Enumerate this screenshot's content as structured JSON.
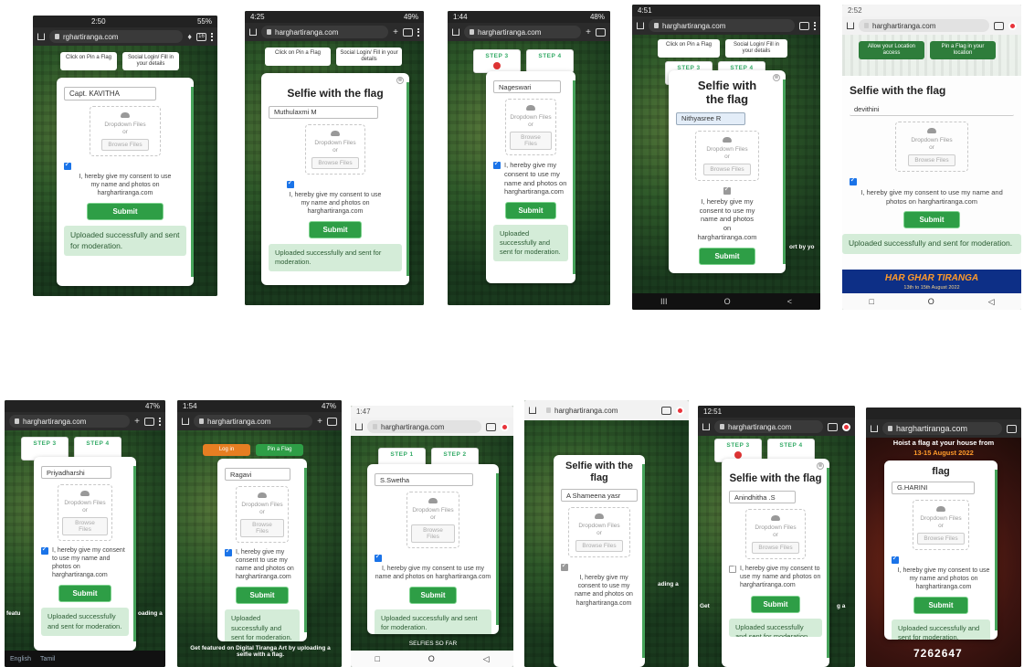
{
  "common": {
    "card_title": "Selfie with the flag",
    "drop_text": "Dropdown Files",
    "or_text": "or",
    "browse_label": "Browse Files",
    "consent_text": "I, hereby give my consent to use my name and photos on harghartiranga.com",
    "submit_label": "Submit",
    "uploaded_text": "Uploaded successfully and sent for moderation.",
    "close_label": "⊗"
  },
  "shots": [
    {
      "status_time": "2:50",
      "status_right": "55%",
      "url": "rghartiranga.com",
      "tabs": "16",
      "tab_labels": [
        "Click on Pin a Flag",
        "Social Login/ Fill in your details"
      ],
      "name": "Capt. KAVITHA"
    },
    {
      "status_time": "4:25",
      "status_right": "49%",
      "url": "harghartiranga.com",
      "tabs": "",
      "tab_labels": [
        "Click on Pin a Flag",
        "Social Login/ Fill in your details"
      ],
      "name": "Muthulaxmi M"
    },
    {
      "status_time": "1:44",
      "status_right": "48%",
      "url": "harghartiranga.com",
      "tabs": "",
      "steps": [
        "STEP 3",
        "STEP 4"
      ],
      "name": "Nageswari"
    },
    {
      "status_time": "4:51",
      "status_right": "",
      "url": "harghartiranga.com",
      "tabs": "",
      "tab_labels": [
        "Click on Pin a Flag",
        "Social Login/ Fill in your details"
      ],
      "steps": [
        "STEP 3",
        "STEP 4"
      ],
      "name": "Nithyasree R",
      "side_text": "ort by\nyo",
      "nav": [
        "III",
        "O",
        "<"
      ]
    },
    {
      "status_time": "2:52",
      "url": "harghartiranga.com",
      "tab_labels": [
        "Allow your Location access",
        "Pin a Flag in your location"
      ],
      "name": "devithini",
      "banner": "HAR GHAR TIRANGA",
      "banner_sub": "13th to 15th August 2022",
      "nav": [
        "□",
        "O",
        "◁"
      ]
    },
    {
      "status_time": "",
      "status_right": "47%",
      "url": "harghartiranga.com",
      "steps": [
        "STEP 3",
        "STEP 4"
      ],
      "name": "Priyadharshi",
      "side_text_left": "featu",
      "side_text_right": "oading a",
      "lang": [
        "English",
        "Tamil"
      ]
    },
    {
      "status_time": "1:54",
      "status_right": "47%",
      "url": "harghartiranga.com",
      "tab_labels": [
        "Log in",
        "Pin a Flag"
      ],
      "name": "Ragavi",
      "footer": "Get featured on Digital Tiranga Art by uploading a selfie with a flag."
    },
    {
      "status_time": "1:47",
      "url": "harghartiranga.com",
      "steps": [
        "STEP 1",
        "STEP 2"
      ],
      "name": "S.Swetha",
      "footer": "SELFIES SO FAR",
      "nav": [
        "□",
        "O",
        "◁"
      ]
    },
    {
      "url": "harghartiranga.com",
      "name": "A Shameena yasr",
      "side_text_right": "ading a",
      "nav": []
    },
    {
      "status_time": "12:51",
      "url": "harghartiranga.com",
      "steps": [
        "STEP 3",
        "STEP 4"
      ],
      "name": "Anindhitha .S",
      "side_text_left": "Get",
      "side_text_right": "g a"
    },
    {
      "status_time": "",
      "url": "harghartiranga.com",
      "name": "G.HARINI",
      "hoist_title": "Hoist a flag at your house from",
      "hoist_dates": "13-15 August 2022",
      "counter": "7262647"
    }
  ]
}
